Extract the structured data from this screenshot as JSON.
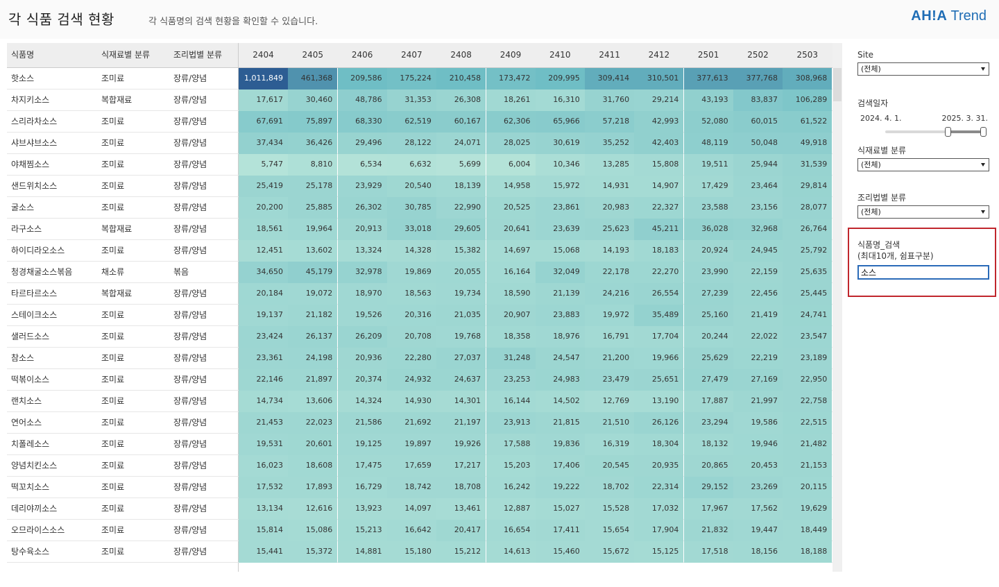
{
  "header": {
    "title": "각 식품 검색 현황",
    "subtitle": "각 식품명의 검색 현황을 확인할 수 있습니다.",
    "logo_strong": "AH!A",
    "logo_light": " Trend"
  },
  "table": {
    "columns": {
      "name": "식품명",
      "ingredient": "식재료별 분류",
      "cooking": "조리법별 분류",
      "months": [
        "2404",
        "2405",
        "2406",
        "2407",
        "2408",
        "2409",
        "2410",
        "2411",
        "2412",
        "2501",
        "2502",
        "2503"
      ]
    },
    "rows": [
      {
        "name": "핫소스",
        "ingredient": "조미료",
        "cooking": "장류/양념",
        "values": [
          1011849,
          461368,
          209586,
          175224,
          210458,
          173472,
          209995,
          309414,
          310501,
          377613,
          377768,
          308968
        ]
      },
      {
        "name": "차지키소스",
        "ingredient": "복합재료",
        "cooking": "장류/양념",
        "values": [
          17617,
          30460,
          48786,
          31353,
          26308,
          18261,
          16310,
          31760,
          29214,
          43193,
          83837,
          106289
        ]
      },
      {
        "name": "스리라차소스",
        "ingredient": "조미료",
        "cooking": "장류/양념",
        "values": [
          67691,
          75897,
          68330,
          62519,
          60167,
          62306,
          65966,
          57218,
          42993,
          52080,
          60015,
          61522
        ]
      },
      {
        "name": "샤브샤브소스",
        "ingredient": "조미료",
        "cooking": "장류/양념",
        "values": [
          37434,
          36426,
          29496,
          28122,
          24071,
          28025,
          30619,
          35252,
          42403,
          48119,
          50048,
          49918
        ]
      },
      {
        "name": "야채찜소스",
        "ingredient": "조미료",
        "cooking": "장류/양념",
        "values": [
          5747,
          8810,
          6534,
          6632,
          5699,
          6004,
          10346,
          13285,
          15808,
          19511,
          25944,
          31539
        ]
      },
      {
        "name": "샌드위치소스",
        "ingredient": "조미료",
        "cooking": "장류/양념",
        "values": [
          25419,
          25178,
          23929,
          20540,
          18139,
          14958,
          15972,
          14931,
          14907,
          17429,
          23464,
          29814
        ]
      },
      {
        "name": "굴소스",
        "ingredient": "조미료",
        "cooking": "장류/양념",
        "values": [
          20200,
          25885,
          26302,
          30785,
          22990,
          20525,
          23861,
          20983,
          22327,
          23588,
          23156,
          28077
        ]
      },
      {
        "name": "라구소스",
        "ingredient": "복합재료",
        "cooking": "장류/양념",
        "values": [
          18561,
          19964,
          20913,
          33018,
          29605,
          20641,
          23639,
          25623,
          45211,
          36028,
          32968,
          26764
        ]
      },
      {
        "name": "하이디라오소스",
        "ingredient": "조미료",
        "cooking": "장류/양념",
        "values": [
          12451,
          13602,
          13324,
          14328,
          15382,
          14697,
          15068,
          14193,
          18183,
          20924,
          24945,
          25792
        ]
      },
      {
        "name": "청경채굴소스볶음",
        "ingredient": "채소류",
        "cooking": "볶음",
        "values": [
          34650,
          45179,
          32978,
          19869,
          20055,
          16164,
          32049,
          22178,
          22270,
          23990,
          22159,
          25635
        ]
      },
      {
        "name": "타르타르소스",
        "ingredient": "복합재료",
        "cooking": "장류/양념",
        "values": [
          20184,
          19072,
          18970,
          18563,
          19734,
          18590,
          21139,
          24216,
          26554,
          27239,
          22456,
          25445
        ]
      },
      {
        "name": "스테이크소스",
        "ingredient": "조미료",
        "cooking": "장류/양념",
        "values": [
          19137,
          21182,
          19526,
          20316,
          21035,
          20907,
          23883,
          19972,
          35489,
          25160,
          21419,
          24741
        ]
      },
      {
        "name": "샐러드소스",
        "ingredient": "조미료",
        "cooking": "장류/양념",
        "values": [
          23424,
          26137,
          26209,
          20708,
          19768,
          18358,
          18976,
          16791,
          17704,
          20244,
          22022,
          23547
        ]
      },
      {
        "name": "참소스",
        "ingredient": "조미료",
        "cooking": "장류/양념",
        "values": [
          23361,
          24198,
          20936,
          22280,
          27037,
          31248,
          24547,
          21200,
          19966,
          25629,
          22219,
          23189
        ]
      },
      {
        "name": "떡볶이소스",
        "ingredient": "조미료",
        "cooking": "장류/양념",
        "values": [
          22146,
          21897,
          20374,
          24932,
          24637,
          23253,
          24983,
          23479,
          25651,
          27479,
          27169,
          22950
        ]
      },
      {
        "name": "랜치소스",
        "ingredient": "조미료",
        "cooking": "장류/양념",
        "values": [
          14734,
          13606,
          14324,
          14930,
          14301,
          16144,
          14502,
          12769,
          13190,
          17887,
          21997,
          22758
        ]
      },
      {
        "name": "연어소스",
        "ingredient": "조미료",
        "cooking": "장류/양념",
        "values": [
          21453,
          22023,
          21586,
          21692,
          21197,
          23913,
          21815,
          21510,
          26126,
          23294,
          19586,
          22515
        ]
      },
      {
        "name": "치폴레소스",
        "ingredient": "조미료",
        "cooking": "장류/양념",
        "values": [
          19531,
          20601,
          19125,
          19897,
          19926,
          17588,
          19836,
          16319,
          18304,
          18132,
          19946,
          21482
        ]
      },
      {
        "name": "양념치킨소스",
        "ingredient": "조미료",
        "cooking": "장류/양념",
        "values": [
          16023,
          18608,
          17475,
          17659,
          17217,
          15203,
          17406,
          20545,
          20935,
          20865,
          20453,
          21153
        ]
      },
      {
        "name": "떡꼬치소스",
        "ingredient": "조미료",
        "cooking": "장류/양념",
        "values": [
          17532,
          17893,
          16729,
          18742,
          18708,
          16242,
          19222,
          18702,
          22314,
          29152,
          23269,
          20115
        ]
      },
      {
        "name": "데리야끼소스",
        "ingredient": "조미료",
        "cooking": "장류/양념",
        "values": [
          13134,
          12616,
          13923,
          14097,
          13461,
          12887,
          15027,
          15528,
          17032,
          17967,
          17562,
          19629
        ]
      },
      {
        "name": "오므라이스소스",
        "ingredient": "조미료",
        "cooking": "장류/양념",
        "values": [
          15814,
          15086,
          15213,
          16642,
          20417,
          16654,
          17411,
          15654,
          17904,
          21832,
          19447,
          18449
        ]
      },
      {
        "name": "탕수육소스",
        "ingredient": "조미료",
        "cooking": "장류/양념",
        "values": [
          15441,
          15372,
          14881,
          15180,
          15212,
          14613,
          15460,
          15672,
          15125,
          17518,
          18156,
          18188
        ]
      }
    ]
  },
  "filters": {
    "site": {
      "label": "Site",
      "value": "(전체)"
    },
    "date": {
      "label": "검색일자",
      "from": "2024. 4. 1.",
      "to": "2025. 3. 31.",
      "range": [
        0.78,
        1.0
      ]
    },
    "ingredient": {
      "label": "식재료별 분류",
      "value": "(전체)"
    },
    "cooking": {
      "label": "조리법별 분류",
      "value": "(전체)"
    },
    "search": {
      "label_line1": "식품명_검색",
      "label_line2": "(최대10개, 쉼표구분)",
      "value": "소스"
    }
  },
  "colors": {
    "heat_low": "#b6e4d9",
    "heat_mid": "#6cbcc4",
    "heat_high": "#2d5d93",
    "search_border": "#c0262c",
    "accent": "#1f6db5"
  }
}
